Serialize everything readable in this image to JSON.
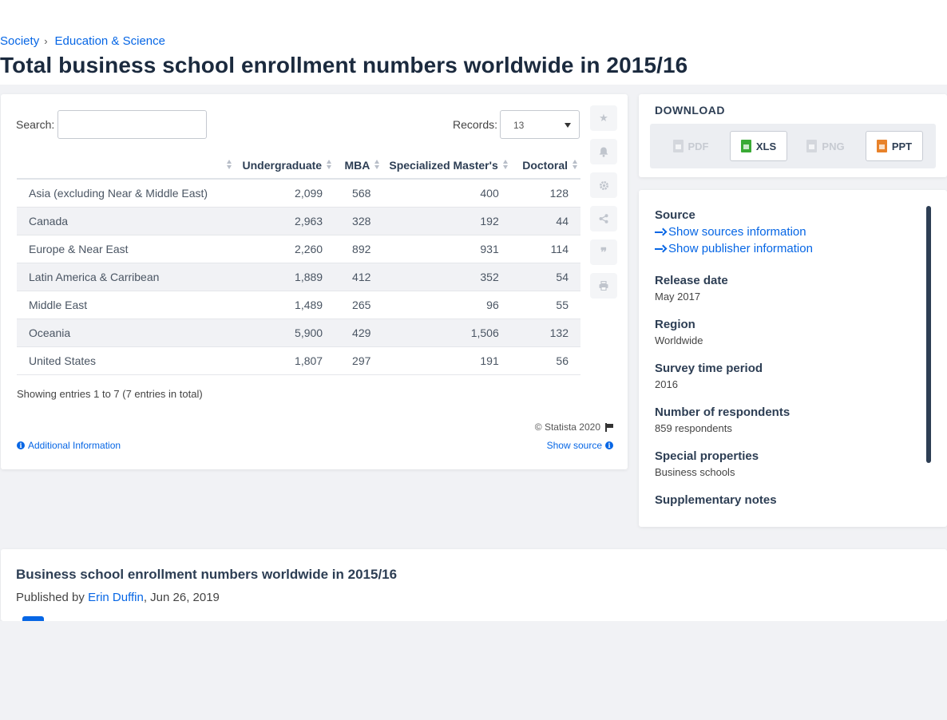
{
  "breadcrumb": {
    "items": [
      "Society",
      "Education & Science"
    ],
    "separator": "›"
  },
  "page_title": "Total business school enrollment numbers worldwide in 2015/16",
  "table_controls": {
    "search_label": "Search:",
    "records_label": "Records:",
    "records_value": "13"
  },
  "table": {
    "columns": [
      "",
      "Undergraduate",
      "MBA",
      "Specialized Master's",
      "Doctoral"
    ],
    "rows": [
      [
        "Asia (excluding Near & Middle East)",
        "2,099",
        "568",
        "400",
        "128"
      ],
      [
        "Canada",
        "2,963",
        "328",
        "192",
        "44"
      ],
      [
        "Europe & Near East",
        "2,260",
        "892",
        "931",
        "114"
      ],
      [
        "Latin America & Carribean",
        "1,889",
        "412",
        "352",
        "54"
      ],
      [
        "Middle East",
        "1,489",
        "265",
        "96",
        "55"
      ],
      [
        "Oceania",
        "5,900",
        "429",
        "1,506",
        "132"
      ],
      [
        "United States",
        "1,807",
        "297",
        "191",
        "56"
      ]
    ]
  },
  "showing_text": "Showing entries 1 to 7 (7 entries in total)",
  "copyright": "© Statista 2020",
  "additional_info": "Additional Information",
  "show_source": "Show source",
  "side_tools": [
    "star-icon",
    "bell-icon",
    "gear-icon",
    "share-icon",
    "quote-icon",
    "print-icon"
  ],
  "download": {
    "title": "DOWNLOAD",
    "buttons": [
      {
        "label": "PDF",
        "enabled": false
      },
      {
        "label": "XLS",
        "enabled": true,
        "color": "#3aaa35"
      },
      {
        "label": "PNG",
        "enabled": false
      },
      {
        "label": "PPT",
        "enabled": true,
        "color": "#e8822a"
      }
    ]
  },
  "info": {
    "source_heading": "Source",
    "show_sources": "Show sources information",
    "show_publisher": "Show publisher information",
    "release_heading": "Release date",
    "release_value": "May 2017",
    "region_heading": "Region",
    "region_value": "Worldwide",
    "survey_heading": "Survey time period",
    "survey_value": "2016",
    "respondents_heading": "Number of respondents",
    "respondents_value": "859 respondents",
    "special_heading": "Special properties",
    "special_value": "Business schools",
    "supplementary_heading": "Supplementary notes"
  },
  "bottom": {
    "title": "Business school enrollment numbers worldwide in 2015/16",
    "published_prefix": "Published by ",
    "author": "Erin Duffin",
    "published_date": ", Jun 26, 2019"
  },
  "colors": {
    "accent": "#0666e5",
    "heading": "#2d3e54",
    "alt_row": "#f1f2f5"
  }
}
